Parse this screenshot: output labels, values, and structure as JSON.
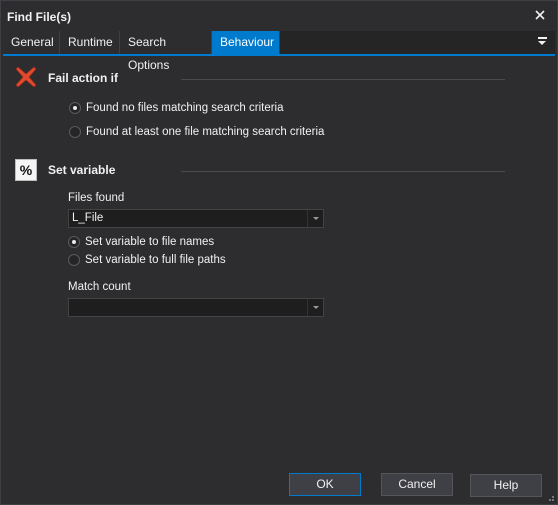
{
  "window": {
    "title": "Find File(s)"
  },
  "tabs": [
    {
      "label": "General"
    },
    {
      "label": "Runtime"
    },
    {
      "label": "Search Options"
    },
    {
      "label": "Behaviour"
    }
  ],
  "active_tab": "Behaviour",
  "fail_action": {
    "title": "Fail action if",
    "icon": "red-x-icon",
    "options": [
      {
        "label": "Found no files matching search criteria",
        "checked": true
      },
      {
        "label": "Found at least one file matching search criteria",
        "checked": false
      }
    ]
  },
  "set_variable": {
    "title": "Set variable",
    "icon": "percent-icon",
    "files_found_label": "Files found",
    "files_found_value": "L_File",
    "options": [
      {
        "label": "Set variable to file names",
        "checked": true
      },
      {
        "label": "Set variable to full file paths",
        "checked": false
      }
    ],
    "match_count_label": "Match count",
    "match_count_value": ""
  },
  "buttons": {
    "ok": "OK",
    "cancel": "Cancel",
    "help": "Help"
  },
  "colors": {
    "accent": "#007acc",
    "background": "#2d2d30",
    "fail_icon": "#e04a2f"
  }
}
